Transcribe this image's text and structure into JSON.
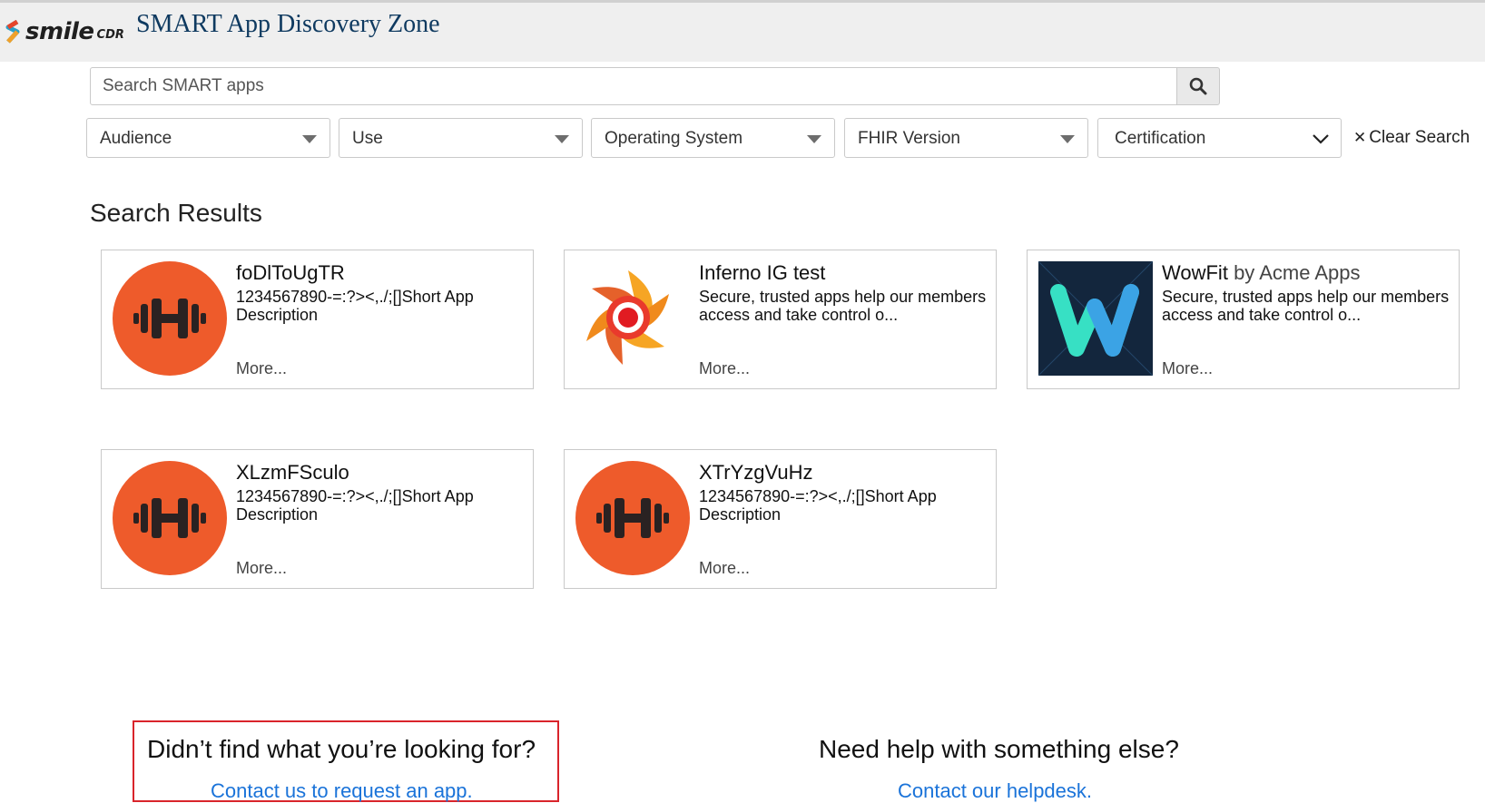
{
  "header": {
    "brand_word": "smile",
    "brand_suffix": "CDR",
    "title": "SMART App Discovery Zone"
  },
  "search": {
    "placeholder": "Search SMART apps",
    "button_icon": "search-icon"
  },
  "filters": [
    {
      "label": "Audience",
      "icon": "caret-down-icon"
    },
    {
      "label": "Use",
      "icon": "caret-down-icon"
    },
    {
      "label": "Operating System",
      "icon": "caret-down-icon"
    },
    {
      "label": "FHIR Version",
      "icon": "caret-down-icon"
    },
    {
      "label": "Certification",
      "icon": "chevron-down-icon"
    }
  ],
  "clear_search": "Clear Search",
  "results": {
    "title": "Search Results",
    "cards": [
      {
        "name": "foDlToUgTR",
        "by": "",
        "description": "1234567890-=:?><,./;[]Short App Description",
        "more": "More...",
        "icon": "dumbbell-icon"
      },
      {
        "name": "Inferno IG test",
        "by": "",
        "description": "Secure, trusted apps help our members access and take control o...",
        "more": "More...",
        "icon": "inferno-logo-icon"
      },
      {
        "name": "WowFit",
        "by": "by Acme Apps",
        "description": "Secure, trusted apps help our members access and take control o...",
        "more": "More...",
        "icon": "wowfit-logo-icon"
      },
      {
        "name": "XLzmFSculo",
        "by": "",
        "description": "1234567890-=:?><,./;[]Short App Description",
        "more": "More...",
        "icon": "dumbbell-icon"
      },
      {
        "name": "XTrYzgVuHz",
        "by": "",
        "description": "1234567890-=:?><,./;[]Short App Description",
        "more": "More...",
        "icon": "dumbbell-icon"
      }
    ]
  },
  "footer": {
    "request": {
      "question": "Didn’t find what you’re looking for?",
      "link": "Contact us to request an app."
    },
    "help": {
      "question": "Need help with something else?",
      "link": "Contact our helpdesk."
    }
  },
  "colors": {
    "header_bg": "#efefef",
    "title_text": "#0f3a60",
    "icon_orange": "#ee5b2b",
    "link_blue": "#1a73d9",
    "highlight_red": "#d9242b",
    "wowfit_bg": "#13263d"
  }
}
